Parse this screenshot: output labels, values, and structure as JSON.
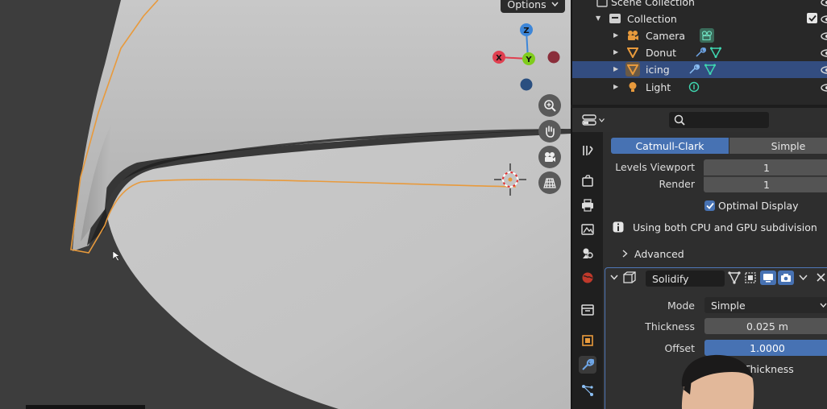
{
  "viewport": {
    "options_label": "Options",
    "gizmo": {
      "z": "Z",
      "x": "X",
      "y": "Y"
    }
  },
  "outliner": {
    "header": "Scene Collection",
    "collection": "Collection",
    "items": [
      {
        "label": "Camera",
        "icon": "camera-icon"
      },
      {
        "label": "Donut",
        "icon": "mesh-icon"
      },
      {
        "label": "icing",
        "icon": "mesh-icon",
        "selected": true
      },
      {
        "label": "Light",
        "icon": "light-icon"
      }
    ]
  },
  "properties": {
    "subdivision": {
      "mode_catmull": "Catmull-Clark",
      "mode_simple": "Simple",
      "levels_viewport_label": "Levels Viewport",
      "levels_viewport_value": "1",
      "render_label": "Render",
      "render_value": "1",
      "optimal_display_label": "Optimal Display",
      "info_text": "Using both CPU and GPU subdivision",
      "advanced_label": "Advanced"
    },
    "solidify": {
      "name": "Solidify",
      "mode_label": "Mode",
      "mode_value": "Simple",
      "thickness_label": "Thickness",
      "thickness_value": "0.025 m",
      "offset_label": "Offset",
      "offset_value": "1.0000",
      "even_thickness_label": "Thickness"
    }
  },
  "colors": {
    "selection_outline": "#e89a3c",
    "accent_blue": "#4772b3",
    "selected_row": "#334d80",
    "gizmo_x": "#e04050",
    "gizmo_y": "#7fcc1c",
    "gizmo_z": "#3d86d8"
  }
}
